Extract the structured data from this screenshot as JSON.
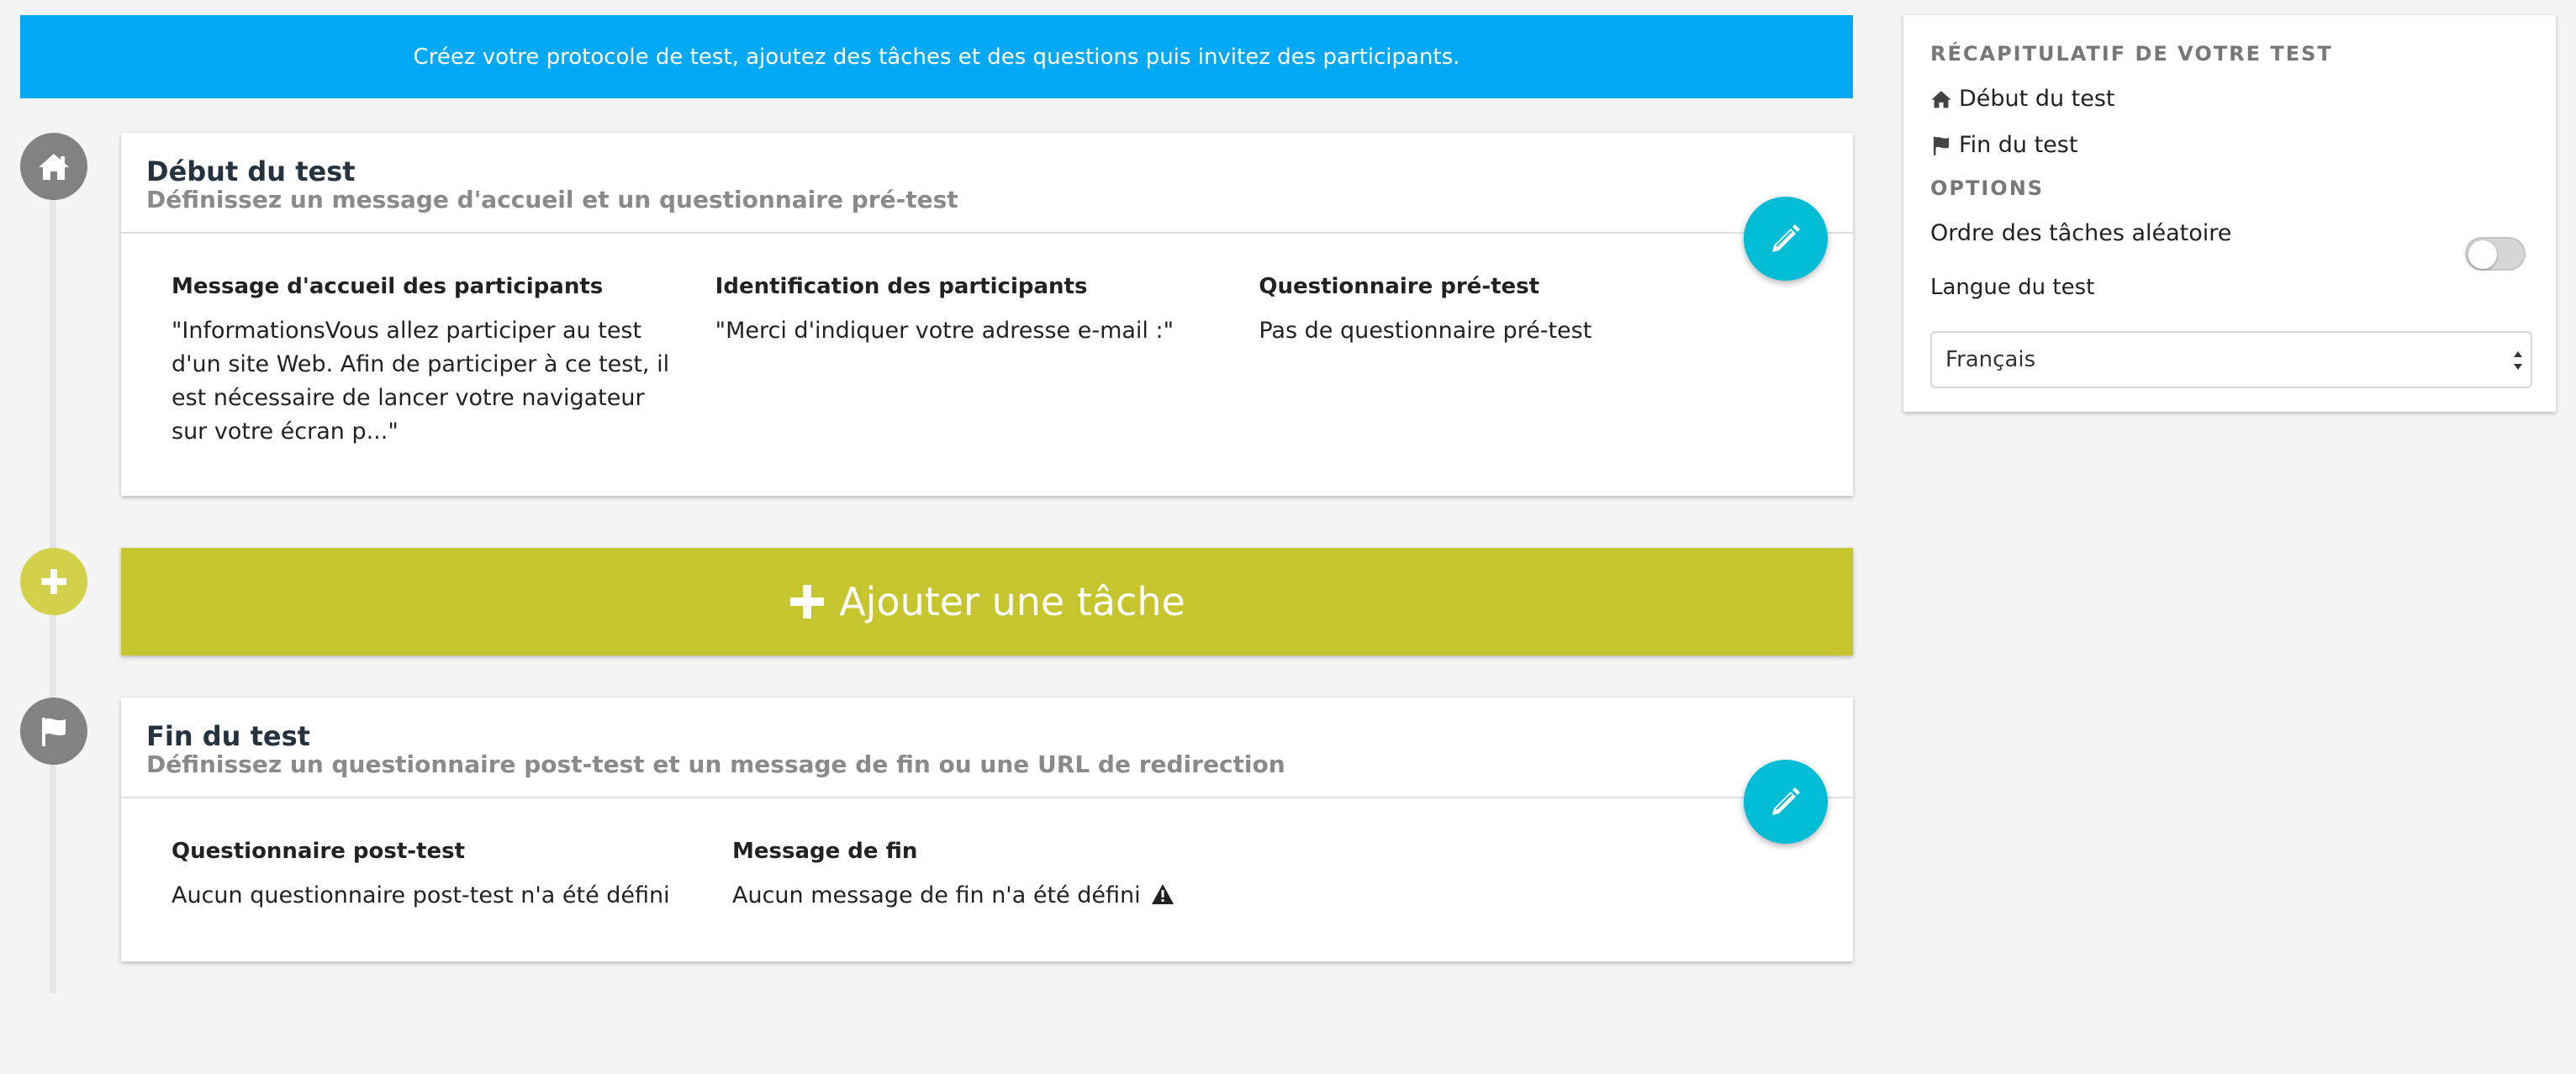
{
  "banner": {
    "text": "Créez votre protocole de test, ajoutez des tâches et des questions puis invitez des participants."
  },
  "start_card": {
    "title": "Début du test",
    "subtitle": "Définissez un message d'accueil et un questionnaire pré-test",
    "columns": [
      {
        "title": "Message d'accueil des participants",
        "text": "\"InformationsVous allez participer au test d'un site Web. Afin de participer à ce test, il est nécessaire de lancer votre navigateur sur votre écran p...\""
      },
      {
        "title": "Identification des participants",
        "text": "\"Merci d'indiquer votre adresse e-mail :\""
      },
      {
        "title": "Questionnaire pré-test",
        "text": "Pas de questionnaire pré-test"
      }
    ]
  },
  "add_task": {
    "label": "Ajouter une tâche"
  },
  "end_card": {
    "title": "Fin du test",
    "subtitle": "Définissez un questionnaire post-test et un message de fin ou une URL de redirection",
    "columns": [
      {
        "title": "Questionnaire post-test",
        "text": "Aucun questionnaire post-test n'a été défini"
      },
      {
        "title": "Message de fin",
        "text": "Aucun message de fin n'a été défini"
      }
    ]
  },
  "sidebar": {
    "summary_heading": "RÉCAPITULATIF DE VOTRE TEST",
    "summary_items": [
      {
        "label": "Début du test",
        "icon": "home-icon"
      },
      {
        "label": "Fin du test",
        "icon": "flag-icon"
      }
    ],
    "options_heading": "OPTIONS",
    "random_order_label": "Ordre des tâches aléatoire",
    "random_order_enabled": false,
    "language_label": "Langue du test",
    "language_value": "Français"
  },
  "colors": {
    "banner": "#03a9f4",
    "add_task": "#c6c52e",
    "fab": "#00bcd4",
    "timeline_icon": "#828282",
    "add_icon": "#d3d04b"
  }
}
